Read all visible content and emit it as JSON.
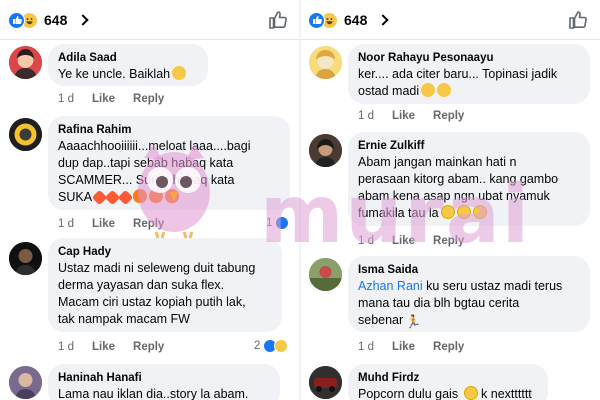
{
  "left": {
    "header": {
      "reaction_count": "648"
    },
    "comments": [
      {
        "name": "Adila Saad",
        "text": "Ye ke uncle. Baiklah",
        "time": "1 d",
        "like": "Like",
        "reply": "Reply"
      },
      {
        "name": "Rafina Rahim",
        "text": "Aaaachhooiiiiii...meloat laaa....bagi\ndup dap..tapi sebab habaq kata\nSCAMMER... Suruh habaq kata\nSUKA",
        "time": "1 d",
        "like": "Like",
        "reply": "Reply",
        "reaction_count": "1"
      },
      {
        "name": "Cap Hady",
        "text": "Ustaz madi ni seleweng duit tabung\nderma yayasan dan suka flex.\nMacam ciri ustaz kopiah putih lak,\ntak nampak macam FW",
        "time": "1 d",
        "like": "Like",
        "reply": "Reply",
        "reaction_count": "2"
      },
      {
        "name": "Haninah Hanafi",
        "text": "Lama nau iklan dia..story la abam."
      }
    ]
  },
  "right": {
    "header": {
      "reaction_count": "648"
    },
    "comments": [
      {
        "name": "Noor Rahayu Pesonaayu",
        "text": "ker.... ada citer baru... Topinasi jadik\nostad madi",
        "time": "1 d",
        "like": "Like",
        "reply": "Reply"
      },
      {
        "name": "Ernie Zulkiff",
        "text": "Abam jangan mainkan hati n\nperasaan kitorg abam.. kang gambo\nabam kena asap ngn ubat nyamuk\nfumakila tau la",
        "time": "1 d",
        "like": "Like",
        "reply": "Reply"
      },
      {
        "name": "Isma Saida",
        "mention": "Azhan Rani",
        "text": " ku seru ustaz madi terus\nmana tau dia blh bgtau cerita\nsebenar",
        "time": "1 d",
        "like": "Like",
        "reply": "Reply"
      },
      {
        "name": "Muhd Firdz",
        "text": "Popcorn dulu gais",
        "text_tail": "k nextttttt"
      }
    ]
  },
  "watermark": "murai",
  "colors": {
    "facebook_blue": "#1877f2",
    "bubble_gray": "#f0f2f5",
    "meta_gray": "#65676b",
    "watermark_pink": "#dea0d6"
  }
}
